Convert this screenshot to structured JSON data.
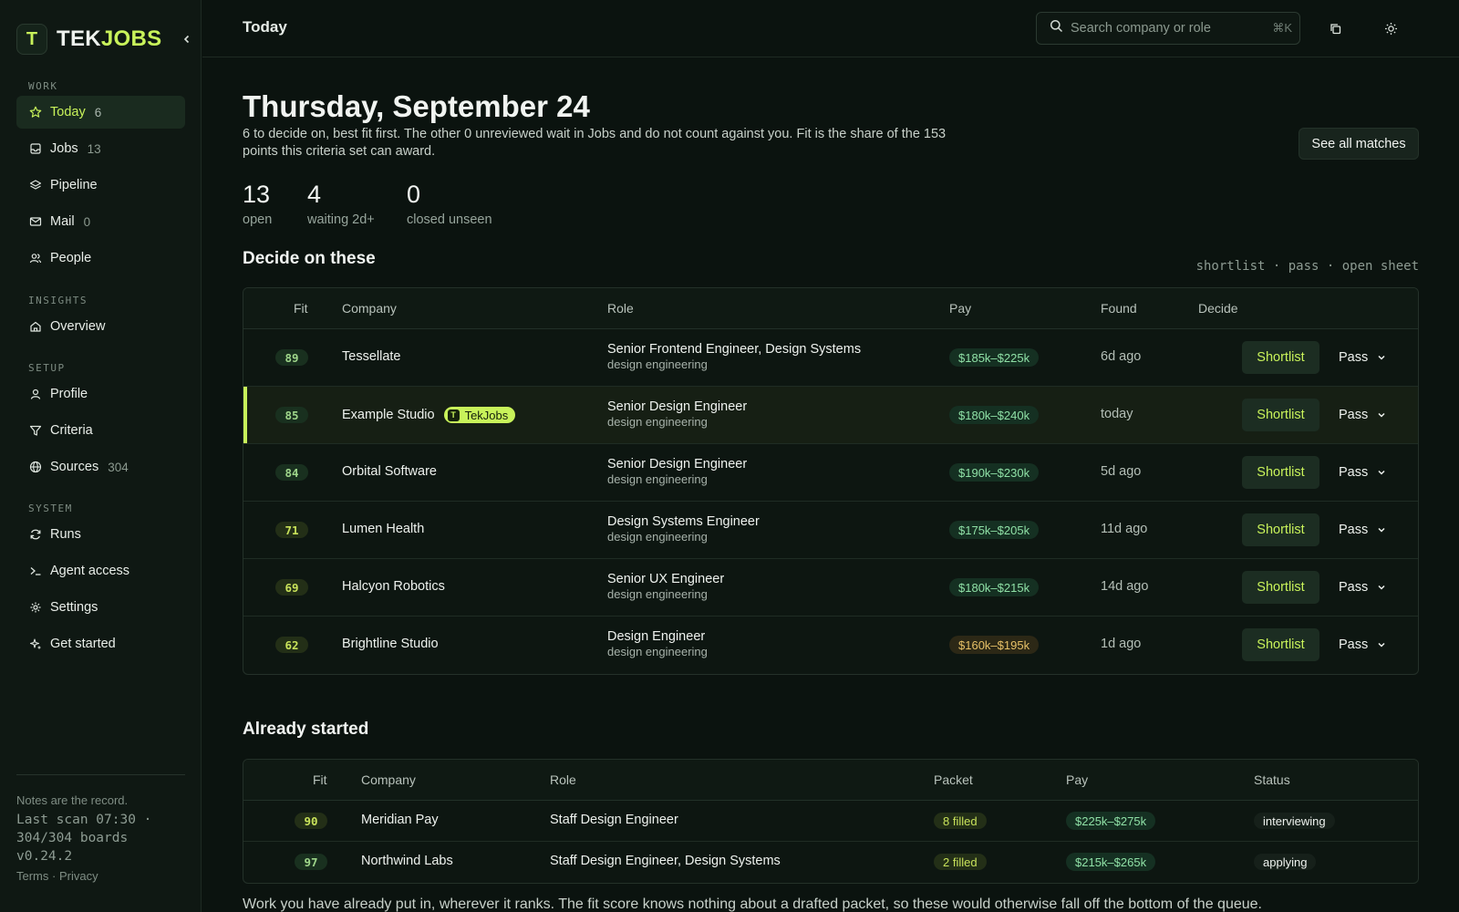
{
  "brand": {
    "mark": "T",
    "name_a": "TEK",
    "name_b": "JOBS"
  },
  "sidebar": {
    "sections": {
      "work": "WORK",
      "insights": "INSIGHTS",
      "setup": "SETUP",
      "system": "SYSTEM"
    },
    "items": {
      "today": {
        "label": "Today",
        "count": "6"
      },
      "jobs": {
        "label": "Jobs",
        "count": "13"
      },
      "pipeline": {
        "label": "Pipeline"
      },
      "mail": {
        "label": "Mail",
        "count": "0"
      },
      "people": {
        "label": "People"
      },
      "overview": {
        "label": "Overview"
      },
      "profile": {
        "label": "Profile"
      },
      "criteria": {
        "label": "Criteria"
      },
      "sources": {
        "label": "Sources",
        "count": "304"
      },
      "runs": {
        "label": "Runs"
      },
      "agent": {
        "label": "Agent access"
      },
      "settings": {
        "label": "Settings"
      },
      "started": {
        "label": "Get started"
      }
    },
    "footer": {
      "note": "Notes are the record.",
      "scan": "Last scan 07:30 · 304/304 boards",
      "version": "v0.24.2",
      "terms": "Terms",
      "sep": " · ",
      "privacy": "Privacy"
    }
  },
  "topbar": {
    "title": "Today",
    "search_placeholder": "Search company or role",
    "search_kbd": "⌘K"
  },
  "header": {
    "date": "Thursday, September 24",
    "subtitle": "6 to decide on, best fit first. The other 0 unreviewed wait in Jobs and do not count against you. Fit is the share of the 153 points this criteria set can award.",
    "see_all": "See all matches"
  },
  "stats": [
    {
      "num": "13",
      "label": "open"
    },
    {
      "num": "4",
      "label": "waiting 2d+"
    },
    {
      "num": "0",
      "label": "closed unseen"
    }
  ],
  "decide": {
    "title": "Decide on these",
    "hint": "shortlist · pass · open sheet",
    "columns": {
      "fit": "Fit",
      "company": "Company",
      "role": "Role",
      "pay": "Pay",
      "found": "Found",
      "decide": "Decide"
    },
    "shortlist_label": "Shortlist",
    "pass_label": "Pass",
    "tag_mark": "T",
    "tag_label": "TekJobs",
    "rows": [
      {
        "fit": "89",
        "company": "Tessellate",
        "role": "Senior Frontend Engineer, Design Systems",
        "role_sub": "design engineering",
        "pay": "$185k–$225k",
        "found": "6d ago"
      },
      {
        "fit": "85",
        "company": "Example Studio",
        "role": "Senior Design Engineer",
        "role_sub": "design engineering",
        "pay": "$180k–$240k",
        "found": "today"
      },
      {
        "fit": "84",
        "company": "Orbital Software",
        "role": "Senior Design Engineer",
        "role_sub": "design engineering",
        "pay": "$190k–$230k",
        "found": "5d ago"
      },
      {
        "fit": "71",
        "company": "Lumen Health",
        "role": "Design Systems Engineer",
        "role_sub": "design engineering",
        "pay": "$175k–$205k",
        "found": "11d ago"
      },
      {
        "fit": "69",
        "company": "Halcyon Robotics",
        "role": "Senior UX Engineer",
        "role_sub": "design engineering",
        "pay": "$180k–$215k",
        "found": "14d ago"
      },
      {
        "fit": "62",
        "company": "Brightline Studio",
        "role": "Design Engineer",
        "role_sub": "design engineering",
        "pay": "$160k–$195k",
        "found": "1d ago"
      }
    ]
  },
  "started": {
    "title": "Already started",
    "columns": {
      "fit": "Fit",
      "company": "Company",
      "role": "Role",
      "packet": "Packet",
      "pay": "Pay",
      "status": "Status"
    },
    "rows": [
      {
        "fit": "90",
        "company": "Meridian Pay",
        "role": "Staff Design Engineer",
        "packet": "8 filled",
        "pay": "$225k–$275k",
        "status": "interviewing"
      },
      {
        "fit": "97",
        "company": "Northwind Labs",
        "role": "Staff Design Engineer, Design Systems",
        "packet": "2 filled",
        "pay": "$215k–$265k",
        "status": "applying"
      }
    ],
    "note": "Work you have already put in, wherever it ranks. The fit score knows nothing about a drafted packet, so these would otherwise fall off the bottom of the queue."
  },
  "colors": {
    "accent": "#c8f25a",
    "bg": "#0b130f",
    "pay_green": "#8fe0a6",
    "pay_amber": "#e6c067"
  }
}
